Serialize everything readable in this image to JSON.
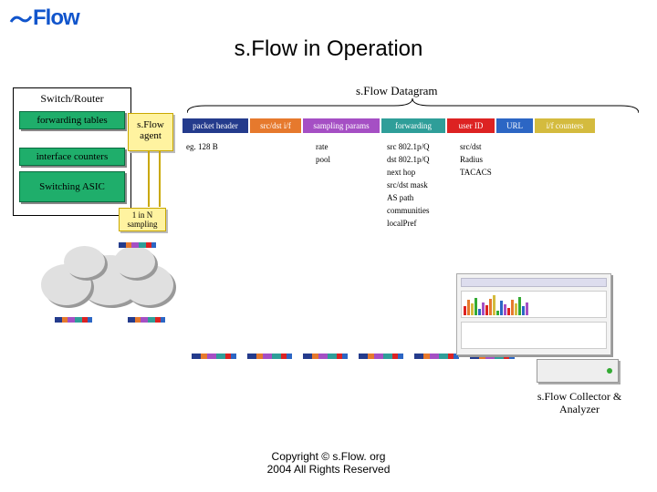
{
  "logo_text": "sFlow",
  "title": "s.Flow in Operation",
  "datagram_label": "s.Flow Datagram",
  "switch": {
    "label": "Switch/Router",
    "box1": "forwarding tables",
    "box2": "interface counters",
    "box3": "Switching ASIC"
  },
  "agent": {
    "line1": "s.Flow",
    "line2": "agent"
  },
  "sampling": {
    "line1": "1 in N",
    "line2": "sampling"
  },
  "headers": {
    "packet_header": "packet header",
    "srcdst_if": "src/dst i/f",
    "sampling_params": "sampling params",
    "forwarding": "forwarding",
    "user_id": "user ID",
    "url": "URL",
    "if_counters": "i/f counters"
  },
  "details": {
    "packet": [
      "eg. 128 B"
    ],
    "sampling": [
      "rate",
      "pool"
    ],
    "forwarding": [
      "src 802.1p/Q",
      "dst 802.1p/Q",
      "next hop",
      "src/dst mask",
      "AS path",
      "communities",
      "localPref"
    ],
    "user": [
      "src/dst",
      "Radius",
      "TACACS"
    ]
  },
  "collector_label": "s.Flow Collector & Analyzer",
  "copyright": "Copyright © s.Flow. org\n2004 All Rights Reserved"
}
